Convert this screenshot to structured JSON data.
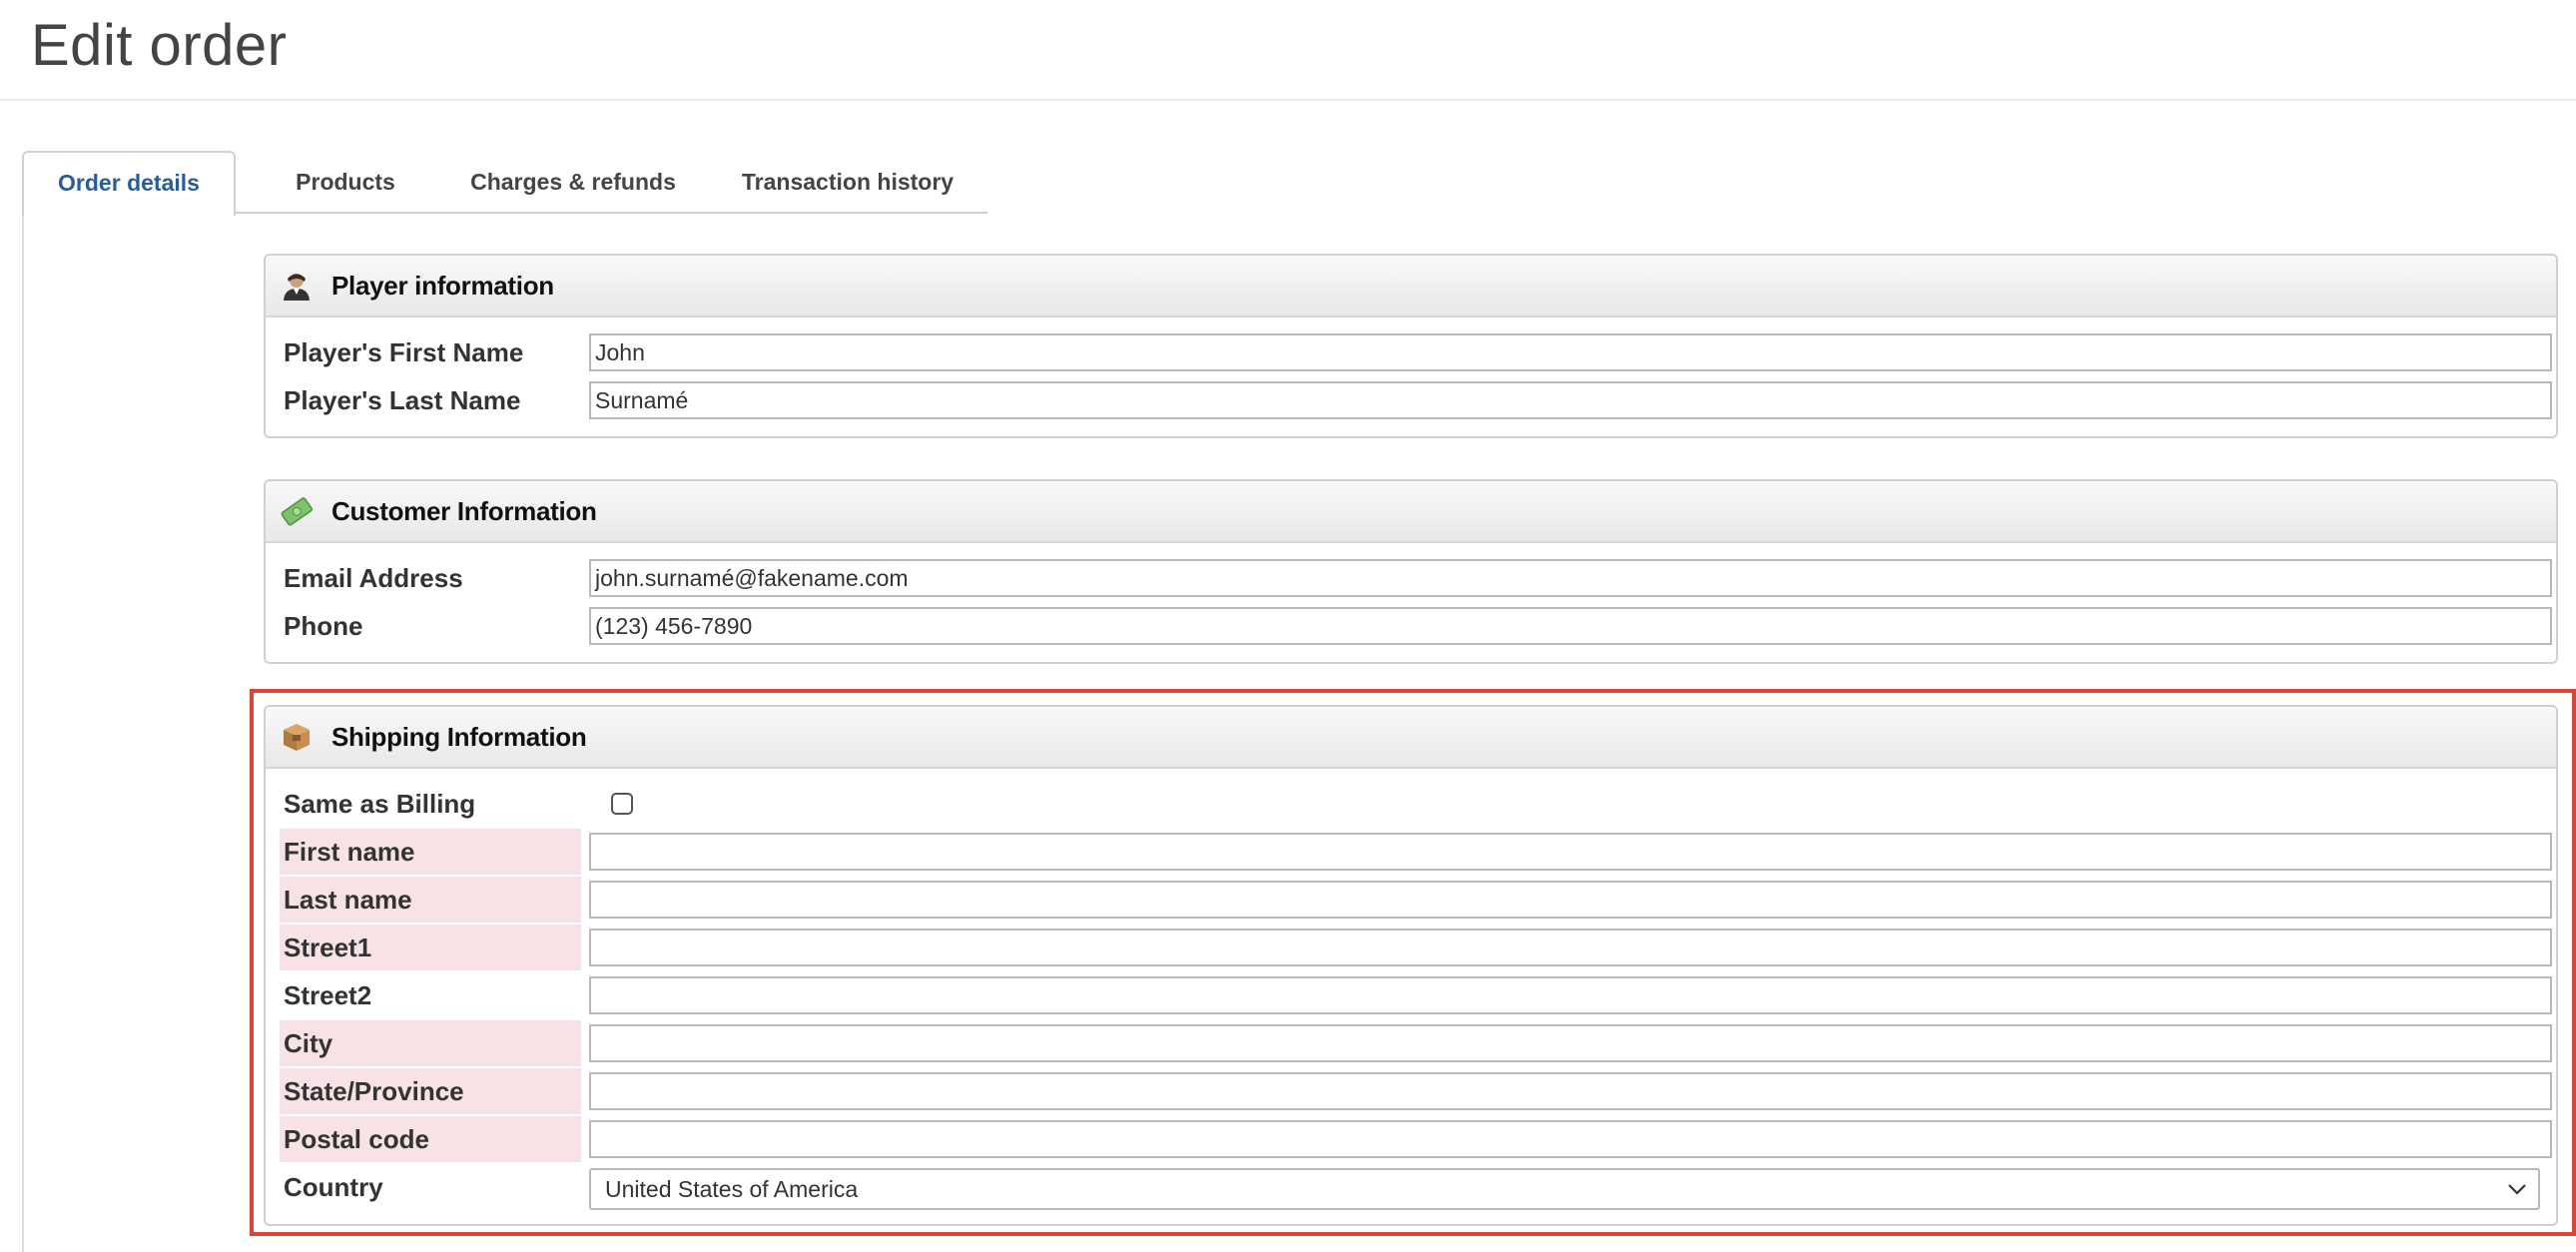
{
  "page": {
    "title": "Edit order"
  },
  "tabs": [
    {
      "label": "Order details",
      "active": true
    },
    {
      "label": "Products"
    },
    {
      "label": "Charges & refunds"
    },
    {
      "label": "Transaction history"
    }
  ],
  "player": {
    "title": "Player information",
    "icon": "person-icon",
    "fields": [
      {
        "label": "Player's First Name",
        "value": "John"
      },
      {
        "label": "Player's Last Name",
        "value": "Surnamé"
      }
    ]
  },
  "customer": {
    "title": "Customer Information",
    "icon": "money-icon",
    "fields": [
      {
        "label": "Email Address",
        "value": "john.surnamé@fakename.com"
      },
      {
        "label": "Phone",
        "value": "(123) 456-7890"
      }
    ]
  },
  "shipping": {
    "title": "Shipping Information",
    "icon": "package-icon",
    "same_as_billing": {
      "label": "Same as Billing",
      "checked": false
    },
    "fields": [
      {
        "label": "First name",
        "value": "",
        "required": true
      },
      {
        "label": "Last name",
        "value": "",
        "required": true
      },
      {
        "label": "Street1",
        "value": "",
        "required": true
      },
      {
        "label": "Street2",
        "value": "",
        "required": false
      },
      {
        "label": "City",
        "value": "",
        "required": true
      },
      {
        "label": "State/Province",
        "value": "",
        "required": true
      },
      {
        "label": "Postal code",
        "value": "",
        "required": true
      }
    ],
    "country": {
      "label": "Country",
      "value": "United States of America"
    }
  },
  "colors": {
    "highlight": "#d94536",
    "required_bg": "#f7e3e5",
    "active_tab": "#2a5c9a"
  }
}
